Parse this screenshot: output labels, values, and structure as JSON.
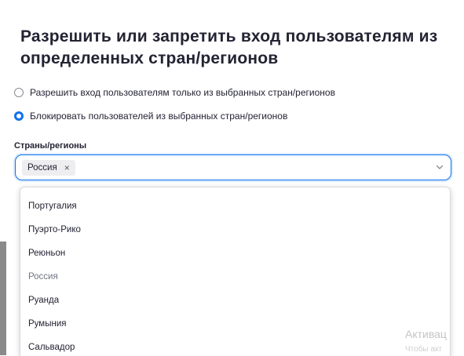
{
  "dialog": {
    "title": "Разрешить или запретить вход пользователям из определенных стран/регионов"
  },
  "options": {
    "allow_label": "Разрешить вход пользователям только из выбранных стран/регионов",
    "block_label": "Блокировать пользователей из выбранных стран/регионов",
    "selected": "block"
  },
  "field": {
    "label": "Страны/регионы",
    "chip_label": "Россия",
    "chip_remove": "×"
  },
  "dropdown": {
    "items": [
      "Португалия",
      "Пуэрто-Рико",
      "Реюньон",
      "Россия",
      "Руанда",
      "Румыния",
      "Сальвадор"
    ]
  },
  "watermark": {
    "line1": "Активац",
    "line2": "Чтобы акт"
  },
  "colors": {
    "accent": "#0e72ed",
    "text": "#232333",
    "backdrop": "#8a8a8a"
  }
}
